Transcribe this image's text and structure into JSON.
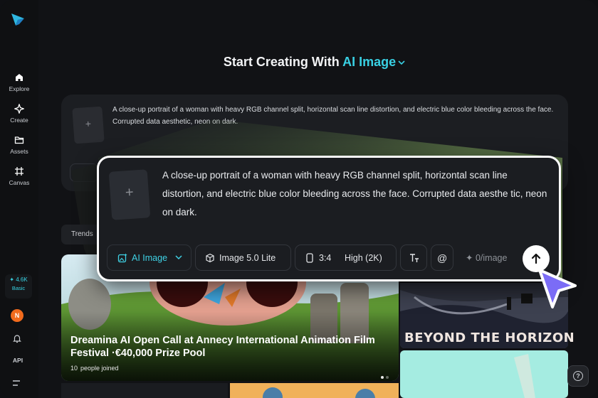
{
  "sidebar": {
    "items": [
      {
        "label": "Explore",
        "icon": "home-icon"
      },
      {
        "label": "Create",
        "icon": "sparkle-icon"
      },
      {
        "label": "Assets",
        "icon": "folder-icon"
      },
      {
        "label": "Canvas",
        "icon": "canvas-grid-icon"
      }
    ],
    "credits": {
      "amount": "✦ 4.6K",
      "plan": "Basic"
    },
    "avatar_initial": "N",
    "api_label": "API"
  },
  "header": {
    "title_prefix": "Start Creating With",
    "title_accent": "AI Image"
  },
  "background_prompt": {
    "text": "A close-up portrait of a woman with heavy RGB channel split, horizontal scan line distortion, and electric blue color bleeding across the face. Corrupted data aesthetic, neon on dark."
  },
  "prompt_card": {
    "text": "A close-up portrait of a woman with heavy RGB channel split, horizontal scan line distortion, and electric blue color bleeding across the face. Corrupted data aesthe tic, neon on dark.",
    "mode_label": "AI Image",
    "model_label": "Image 5.0 Lite",
    "ratio_label": "3:4",
    "quality_label": "High (2K)",
    "at_label": "@",
    "cost_label": "0/image"
  },
  "feed": {
    "tab_label": "Trends",
    "featured": {
      "title": "Dreamina AI Open Call at Annecy International Animation Film Festival ·€40,000 Prize Pool",
      "joined_count": "10",
      "joined_label": "people joined"
    },
    "side_card_title": "BEYOND THE HORIZON"
  },
  "colors": {
    "accent": "#39d0e3",
    "background": "#111215",
    "card": "#1b1d21",
    "cursor": "#7b6cf6"
  }
}
